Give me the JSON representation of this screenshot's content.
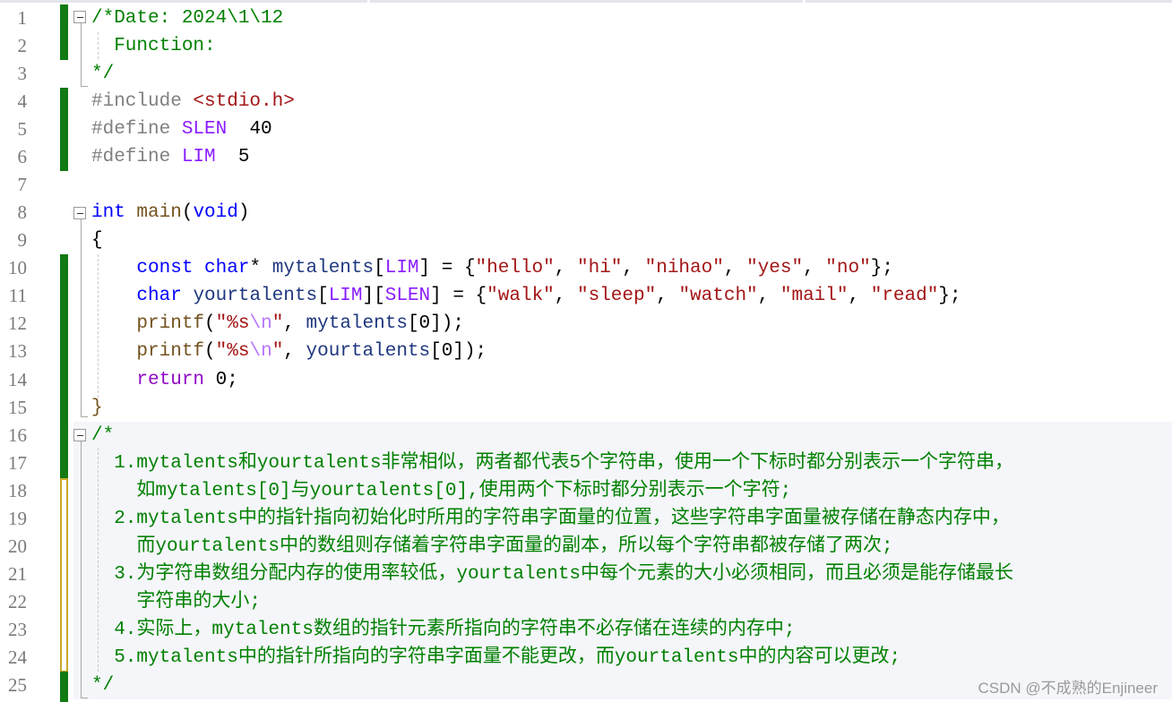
{
  "editor": {
    "lines": [
      {
        "n": "1",
        "tokens": [
          {
            "k": "cm",
            "t": "/*Date: 2024\\1\\12"
          }
        ]
      },
      {
        "n": "2",
        "tokens": [
          {
            "k": "cm",
            "t": "  Function:"
          }
        ]
      },
      {
        "n": "3",
        "tokens": [
          {
            "k": "cm",
            "t": "*/"
          }
        ]
      },
      {
        "n": "4",
        "tokens": [
          {
            "k": "pp",
            "t": "#include "
          },
          {
            "k": "inc",
            "t": "<stdio.h>"
          }
        ]
      },
      {
        "n": "5",
        "tokens": [
          {
            "k": "pp",
            "t": "#define "
          },
          {
            "k": "mac",
            "t": "SLEN"
          },
          {
            "k": "num",
            "t": "  40"
          }
        ]
      },
      {
        "n": "6",
        "tokens": [
          {
            "k": "pp",
            "t": "#define "
          },
          {
            "k": "mac",
            "t": "LIM"
          },
          {
            "k": "num",
            "t": "  5"
          }
        ]
      },
      {
        "n": "7",
        "tokens": []
      },
      {
        "n": "8",
        "tokens": [
          {
            "k": "kw",
            "t": "int"
          },
          {
            "k": "p",
            "t": " "
          },
          {
            "k": "fn",
            "t": "main"
          },
          {
            "k": "p",
            "t": "("
          },
          {
            "k": "kw",
            "t": "void"
          },
          {
            "k": "p",
            "t": ")"
          }
        ]
      },
      {
        "n": "9",
        "tokens": [
          {
            "k": "p",
            "t": "{"
          }
        ]
      },
      {
        "n": "10",
        "tokens": [
          {
            "k": "p",
            "t": "    "
          },
          {
            "k": "kw",
            "t": "const"
          },
          {
            "k": "p",
            "t": " "
          },
          {
            "k": "kw",
            "t": "char"
          },
          {
            "k": "p",
            "t": "* "
          },
          {
            "k": "var",
            "t": "mytalents"
          },
          {
            "k": "p",
            "t": "["
          },
          {
            "k": "mac",
            "t": "LIM"
          },
          {
            "k": "p",
            "t": "] = {"
          },
          {
            "k": "str",
            "t": "\"hello\""
          },
          {
            "k": "p",
            "t": ", "
          },
          {
            "k": "str",
            "t": "\"hi\""
          },
          {
            "k": "p",
            "t": ", "
          },
          {
            "k": "str",
            "t": "\"nihao\""
          },
          {
            "k": "p",
            "t": ", "
          },
          {
            "k": "str",
            "t": "\"yes\""
          },
          {
            "k": "p",
            "t": ", "
          },
          {
            "k": "str",
            "t": "\"no\""
          },
          {
            "k": "p",
            "t": "};"
          }
        ]
      },
      {
        "n": "11",
        "tokens": [
          {
            "k": "p",
            "t": "    "
          },
          {
            "k": "kw",
            "t": "char"
          },
          {
            "k": "p",
            "t": " "
          },
          {
            "k": "var",
            "t": "yourtalents"
          },
          {
            "k": "p",
            "t": "["
          },
          {
            "k": "mac",
            "t": "LIM"
          },
          {
            "k": "p",
            "t": "]["
          },
          {
            "k": "mac",
            "t": "SLEN"
          },
          {
            "k": "p",
            "t": "] = {"
          },
          {
            "k": "str",
            "t": "\"walk\""
          },
          {
            "k": "p",
            "t": ", "
          },
          {
            "k": "str",
            "t": "\"sleep\""
          },
          {
            "k": "p",
            "t": ", "
          },
          {
            "k": "str",
            "t": "\"watch\""
          },
          {
            "k": "p",
            "t": ", "
          },
          {
            "k": "str",
            "t": "\"mail\""
          },
          {
            "k": "p",
            "t": ", "
          },
          {
            "k": "str",
            "t": "\"read\""
          },
          {
            "k": "p",
            "t": "};"
          }
        ]
      },
      {
        "n": "12",
        "tokens": [
          {
            "k": "p",
            "t": "    "
          },
          {
            "k": "fn",
            "t": "printf"
          },
          {
            "k": "p",
            "t": "("
          },
          {
            "k": "str",
            "t": "\"%s"
          },
          {
            "k": "esc",
            "t": "\\n"
          },
          {
            "k": "str",
            "t": "\""
          },
          {
            "k": "p",
            "t": ", "
          },
          {
            "k": "var",
            "t": "mytalents"
          },
          {
            "k": "p",
            "t": "[0]);"
          }
        ]
      },
      {
        "n": "13",
        "tokens": [
          {
            "k": "p",
            "t": "    "
          },
          {
            "k": "fn",
            "t": "printf"
          },
          {
            "k": "p",
            "t": "("
          },
          {
            "k": "str",
            "t": "\"%s"
          },
          {
            "k": "esc",
            "t": "\\n"
          },
          {
            "k": "str",
            "t": "\""
          },
          {
            "k": "p",
            "t": ", "
          },
          {
            "k": "var",
            "t": "yourtalents"
          },
          {
            "k": "p",
            "t": "[0]);"
          }
        ]
      },
      {
        "n": "14",
        "tokens": [
          {
            "k": "p",
            "t": "    "
          },
          {
            "k": "ret",
            "t": "return"
          },
          {
            "k": "p",
            "t": " 0;"
          }
        ]
      },
      {
        "n": "15",
        "tokens": [
          {
            "k": "fn",
            "t": "}"
          }
        ]
      },
      {
        "n": "16",
        "tokens": [
          {
            "k": "cm",
            "t": "/*"
          }
        ]
      },
      {
        "n": "17",
        "tokens": [
          {
            "k": "cm",
            "t": "  1.mytalents和yourtalents非常相似，两者都代表5个字符串，使用一个下标时都分别表示一个字符串，"
          }
        ]
      },
      {
        "n": "18",
        "tokens": [
          {
            "k": "cm",
            "t": "    如mytalents[0]与yourtalents[0],使用两个下标时都分别表示一个字符;"
          }
        ]
      },
      {
        "n": "19",
        "tokens": [
          {
            "k": "cm",
            "t": "  2.mytalents中的指针指向初始化时所用的字符串字面量的位置，这些字符串字面量被存储在静态内存中，"
          }
        ]
      },
      {
        "n": "20",
        "tokens": [
          {
            "k": "cm",
            "t": "    而yourtalents中的数组则存储着字符串字面量的副本，所以每个字符串都被存储了两次;"
          }
        ]
      },
      {
        "n": "21",
        "tokens": [
          {
            "k": "cm",
            "t": "  3.为字符串数组分配内存的使用率较低，yourtalents中每个元素的大小必须相同，而且必须是能存储最长"
          }
        ]
      },
      {
        "n": "22",
        "tokens": [
          {
            "k": "cm",
            "t": "    字符串的大小;"
          }
        ]
      },
      {
        "n": "23",
        "tokens": [
          {
            "k": "cm",
            "t": "  4.实际上，mytalents数组的指针元素所指向的字符串不必存储在连续的内存中;"
          }
        ]
      },
      {
        "n": "24",
        "tokens": [
          {
            "k": "cm",
            "t": "  5.mytalents中的指针所指向的字符串字面量不能更改，而yourtalents中的内容可以更改;"
          }
        ]
      },
      {
        "n": "25",
        "tokens": [
          {
            "k": "cm",
            "t": "*/"
          }
        ]
      }
    ]
  },
  "colors": {
    "comment": "#008000",
    "keyword": "#0000ff",
    "string": "#a31515",
    "macro": "#8a1bff",
    "change_bar_saved": "#127a12",
    "change_bar_unsaved": "#c8a82a"
  },
  "watermark": "CSDN @不成熟的Enjineer"
}
